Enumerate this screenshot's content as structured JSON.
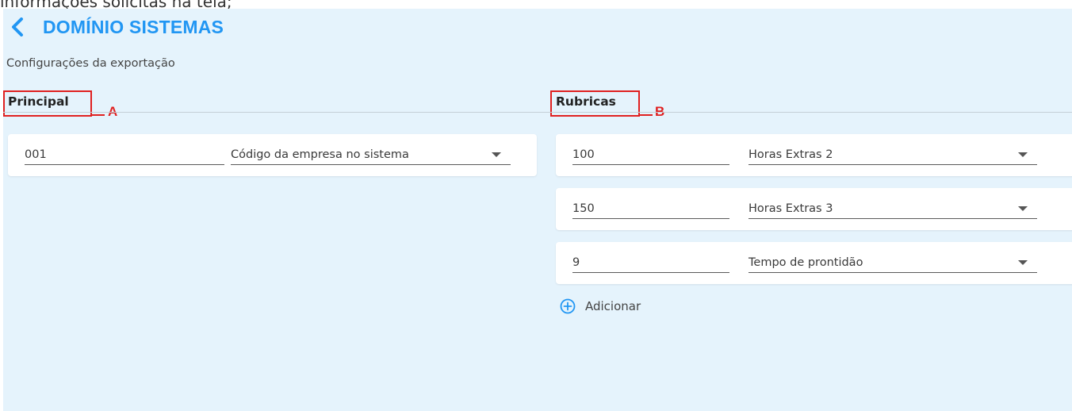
{
  "caption": "informações solicitas na tela;",
  "header": {
    "title": "DOMÍNIO SISTEMAS",
    "back_icon": "chevron-left-icon"
  },
  "subtitle": "Configurações da exportação",
  "colors": {
    "accent": "#2196f3",
    "panel_bg": "#e5f3fc",
    "annotation": "#e02020"
  },
  "principal": {
    "title": "Principal",
    "annotation": "A",
    "items": [
      {
        "value": "001",
        "select": "Código da empresa no sistema"
      }
    ]
  },
  "rubricas": {
    "title": "Rubricas",
    "annotation": "B",
    "items": [
      {
        "value": "100",
        "select": "Horas Extras 2"
      },
      {
        "value": "150",
        "select": "Horas Extras 3"
      },
      {
        "value": "9",
        "select": "Tempo de prontidão"
      }
    ],
    "add_label": "Adicionar",
    "add_icon": "plus-circle-icon"
  }
}
